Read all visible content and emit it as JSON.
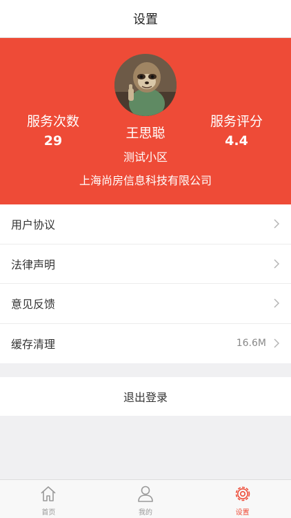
{
  "header": {
    "title": "设置"
  },
  "profile": {
    "service_count_label": "服务次数",
    "service_count_value": "29",
    "service_rating_label": "服务评分",
    "service_rating_value": "4.4",
    "name": "王思聪",
    "community": "测试小区",
    "company": "上海尚房信息科技有限公司",
    "background_color": "#ee4b37"
  },
  "menu": {
    "items": [
      {
        "label": "用户协议",
        "extra": ""
      },
      {
        "label": "法律声明",
        "extra": ""
      },
      {
        "label": "意见反馈",
        "extra": ""
      },
      {
        "label": "缓存清理",
        "extra": "16.6M"
      }
    ]
  },
  "logout": {
    "label": "退出登录"
  },
  "tabbar": {
    "tabs": [
      {
        "label": "首页",
        "icon": "home-icon",
        "active": false
      },
      {
        "label": "我的",
        "icon": "user-icon",
        "active": false
      },
      {
        "label": "设置",
        "icon": "gear-icon",
        "active": true
      }
    ],
    "active_color": "#ee4b37",
    "inactive_color": "#999999"
  }
}
